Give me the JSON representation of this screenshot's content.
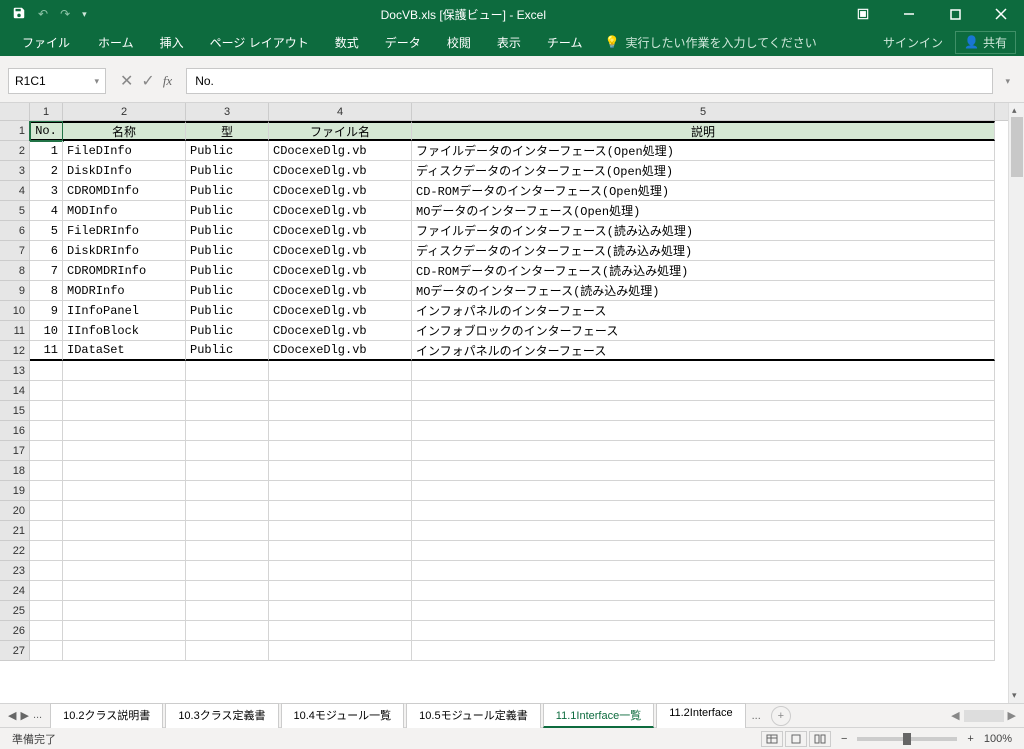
{
  "window": {
    "title": "DocVB.xls  [保護ビュー] - Excel"
  },
  "ribbon": {
    "file": "ファイル",
    "tabs": [
      "ホーム",
      "挿入",
      "ページ レイアウト",
      "数式",
      "データ",
      "校閲",
      "表示",
      "チーム"
    ],
    "tellme": "実行したい作業を入力してください",
    "signin": "サインイン",
    "share": "共有"
  },
  "formulabar": {
    "namebox": "R1C1",
    "formula": "No."
  },
  "columns": {
    "widths": [
      33,
      123,
      83,
      143,
      583
    ],
    "labels": [
      "1",
      "2",
      "3",
      "4",
      "5"
    ]
  },
  "headerRow": [
    "No.",
    "名称",
    "型",
    "ファイル名",
    "説明"
  ],
  "rows": [
    {
      "n": "1",
      "name": "FileDInfo",
      "type": "Public",
      "file": "CDocexeDlg.vb",
      "desc": "ファイルデータのインターフェース(Open処理)"
    },
    {
      "n": "2",
      "name": "DiskDInfo",
      "type": "Public",
      "file": "CDocexeDlg.vb",
      "desc": "ディスクデータのインターフェース(Open処理)"
    },
    {
      "n": "3",
      "name": "CDROMDInfo",
      "type": "Public",
      "file": "CDocexeDlg.vb",
      "desc": "CD-ROMデータのインターフェース(Open処理)"
    },
    {
      "n": "4",
      "name": "MODInfo",
      "type": "Public",
      "file": "CDocexeDlg.vb",
      "desc": "MOデータのインターフェース(Open処理)"
    },
    {
      "n": "5",
      "name": "FileDRInfo",
      "type": "Public",
      "file": "CDocexeDlg.vb",
      "desc": "ファイルデータのインターフェース(読み込み処理)"
    },
    {
      "n": "6",
      "name": "DiskDRInfo",
      "type": "Public",
      "file": "CDocexeDlg.vb",
      "desc": "ディスクデータのインターフェース(読み込み処理)"
    },
    {
      "n": "7",
      "name": "CDROMDRInfo",
      "type": "Public",
      "file": "CDocexeDlg.vb",
      "desc": "CD-ROMデータのインターフェース(読み込み処理)"
    },
    {
      "n": "8",
      "name": "MODRInfo",
      "type": "Public",
      "file": "CDocexeDlg.vb",
      "desc": "MOデータのインターフェース(読み込み処理)"
    },
    {
      "n": "9",
      "name": "IInfoPanel",
      "type": "Public",
      "file": "CDocexeDlg.vb",
      "desc": "インフォパネルのインターフェース"
    },
    {
      "n": "10",
      "name": "IInfoBlock",
      "type": "Public",
      "file": "CDocexeDlg.vb",
      "desc": "インフォブロックのインターフェース"
    },
    {
      "n": "11",
      "name": "IDataSet",
      "type": "Public",
      "file": "CDocexeDlg.vb",
      "desc": "インフォパネルのインターフェース"
    }
  ],
  "emptyRows": 15,
  "sheets": {
    "ellipsis": "...",
    "tabs": [
      "10.2クラス説明書",
      "10.3クラス定義書",
      "10.4モジュール一覧",
      "10.5モジュール定義書",
      "11.1Interface一覧",
      "11.2Interface"
    ],
    "active": "11.1Interface一覧",
    "more": "..."
  },
  "status": {
    "ready": "準備完了",
    "zoom": "100%"
  }
}
